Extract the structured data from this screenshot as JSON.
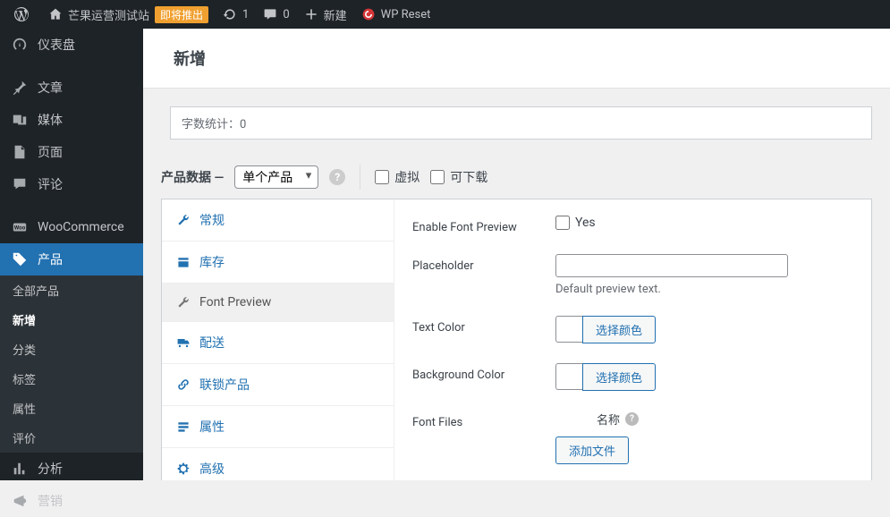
{
  "adminbar": {
    "site_name": "芒果运营测试站",
    "coming_soon": "即将推出",
    "updates": "1",
    "comments": "0",
    "new": "新建",
    "wp_reset": "WP Reset"
  },
  "sidebar": {
    "dashboard": "仪表盘",
    "posts": "文章",
    "media": "媒体",
    "pages": "页面",
    "comments": "评论",
    "woocommerce": "WooCommerce",
    "products": "产品",
    "analytics": "分析",
    "marketing": "营销",
    "submenu": {
      "all": "全部产品",
      "add_new": "新增",
      "categories": "分类",
      "tags": "标签",
      "attributes": "属性",
      "reviews": "评价"
    }
  },
  "header": {
    "title": "新增"
  },
  "wordcount": {
    "label": "字数统计：",
    "value": "0"
  },
  "product_data": {
    "title": "产品数据",
    "dash": " —",
    "type_selected": "单个产品",
    "virtual": "虚拟",
    "downloadable": "可下载",
    "tabs": {
      "general": "常规",
      "inventory": "库存",
      "font_preview": "Font Preview",
      "shipping": "配送",
      "linked": "联锁产品",
      "attributes": "属性",
      "advanced": "高级"
    }
  },
  "font_preview_panel": {
    "enable_label": "Enable Font Preview",
    "enable_yes": "Yes",
    "placeholder_label": "Placeholder",
    "placeholder_desc": "Default preview text.",
    "text_color_label": "Text Color",
    "bg_color_label": "Background Color",
    "select_color": "选择颜色",
    "font_files_label": "Font Files",
    "name_col": "名称",
    "add_file": "添加文件"
  }
}
